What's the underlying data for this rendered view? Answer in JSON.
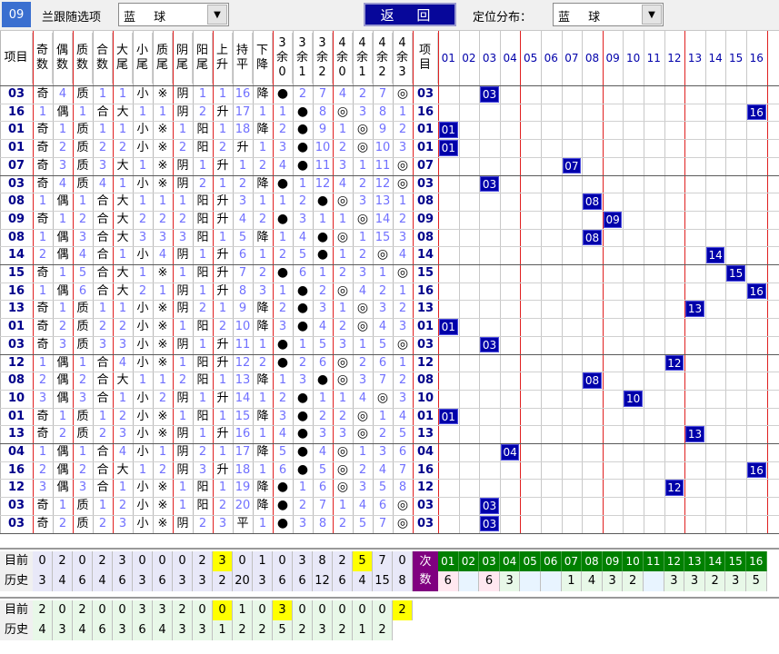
{
  "toolbar": {
    "issue": "09",
    "select_label": "兰跟随选项",
    "select_value": "蓝 球",
    "back_label": "返 回",
    "dist_label": "定位分布：",
    "dist_value": "蓝 球"
  },
  "headers": [
    "项目",
    "奇数",
    "偶数",
    "质数",
    "合数",
    "大尾",
    "小尾",
    "质尾",
    "阴尾",
    "阳尾",
    "上升",
    "持平",
    "下降",
    "3余0",
    "3余1",
    "3余2",
    "4余0",
    "4余1",
    "4余2",
    "4余3",
    "项目"
  ],
  "nums": [
    "01",
    "02",
    "03",
    "04",
    "05",
    "06",
    "07",
    "08",
    "09",
    "10",
    "11",
    "12",
    "13",
    "14",
    "15",
    "16"
  ],
  "rows": [
    [
      "03",
      "奇",
      "4",
      "质",
      "1",
      "1",
      "小",
      "※",
      "阴",
      "1",
      "1",
      "16",
      "降",
      "●",
      "2",
      "7",
      "4",
      "2",
      "7",
      "◎",
      "03"
    ],
    [
      "16",
      "1",
      "偶",
      "1",
      "合",
      "大",
      "1",
      "1",
      "阴",
      "2",
      "升",
      "17",
      "1",
      "1",
      "●",
      "8",
      "◎",
      "3",
      "8",
      "1",
      "16"
    ],
    [
      "01",
      "奇",
      "1",
      "质",
      "1",
      "1",
      "小",
      "※",
      "1",
      "阳",
      "1",
      "18",
      "降",
      "2",
      "●",
      "9",
      "1",
      "◎",
      "9",
      "2",
      "01"
    ],
    [
      "01",
      "奇",
      "2",
      "质",
      "2",
      "2",
      "小",
      "※",
      "2",
      "阳",
      "2",
      "升",
      "1",
      "3",
      "●",
      "10",
      "2",
      "◎",
      "10",
      "3",
      "01"
    ],
    [
      "07",
      "奇",
      "3",
      "质",
      "3",
      "大",
      "1",
      "※",
      "阴",
      "1",
      "升",
      "1",
      "2",
      "4",
      "●",
      "11",
      "3",
      "1",
      "11",
      "◎",
      "07"
    ],
    [
      "03",
      "奇",
      "4",
      "质",
      "4",
      "1",
      "小",
      "※",
      "阴",
      "2",
      "1",
      "2",
      "降",
      "●",
      "1",
      "12",
      "4",
      "2",
      "12",
      "◎",
      "03"
    ],
    [
      "08",
      "1",
      "偶",
      "1",
      "合",
      "大",
      "1",
      "1",
      "1",
      "阳",
      "升",
      "3",
      "1",
      "1",
      "2",
      "●",
      "◎",
      "3",
      "13",
      "1",
      "08"
    ],
    [
      "09",
      "奇",
      "1",
      "2",
      "合",
      "大",
      "2",
      "2",
      "2",
      "阳",
      "升",
      "4",
      "2",
      "●",
      "3",
      "1",
      "1",
      "◎",
      "14",
      "2",
      "09"
    ],
    [
      "08",
      "1",
      "偶",
      "3",
      "合",
      "大",
      "3",
      "3",
      "3",
      "阳",
      "1",
      "5",
      "降",
      "1",
      "4",
      "●",
      "◎",
      "1",
      "15",
      "3",
      "08"
    ],
    [
      "14",
      "2",
      "偶",
      "4",
      "合",
      "1",
      "小",
      "4",
      "阴",
      "1",
      "升",
      "6",
      "1",
      "2",
      "5",
      "●",
      "1",
      "2",
      "◎",
      "4",
      "14"
    ],
    [
      "15",
      "奇",
      "1",
      "5",
      "合",
      "大",
      "1",
      "※",
      "1",
      "阳",
      "升",
      "7",
      "2",
      "●",
      "6",
      "1",
      "2",
      "3",
      "1",
      "◎",
      "15"
    ],
    [
      "16",
      "1",
      "偶",
      "6",
      "合",
      "大",
      "2",
      "1",
      "阴",
      "1",
      "升",
      "8",
      "3",
      "1",
      "●",
      "2",
      "◎",
      "4",
      "2",
      "1",
      "16"
    ],
    [
      "13",
      "奇",
      "1",
      "质",
      "1",
      "1",
      "小",
      "※",
      "阴",
      "2",
      "1",
      "9",
      "降",
      "2",
      "●",
      "3",
      "1",
      "◎",
      "3",
      "2",
      "13"
    ],
    [
      "01",
      "奇",
      "2",
      "质",
      "2",
      "2",
      "小",
      "※",
      "1",
      "阳",
      "2",
      "10",
      "降",
      "3",
      "●",
      "4",
      "2",
      "◎",
      "4",
      "3",
      "01"
    ],
    [
      "03",
      "奇",
      "3",
      "质",
      "3",
      "3",
      "小",
      "※",
      "阴",
      "1",
      "升",
      "11",
      "1",
      "●",
      "1",
      "5",
      "3",
      "1",
      "5",
      "◎",
      "03"
    ],
    [
      "12",
      "1",
      "偶",
      "1",
      "合",
      "4",
      "小",
      "※",
      "1",
      "阳",
      "升",
      "12",
      "2",
      "●",
      "2",
      "6",
      "◎",
      "2",
      "6",
      "1",
      "12"
    ],
    [
      "08",
      "2",
      "偶",
      "2",
      "合",
      "大",
      "1",
      "1",
      "2",
      "阳",
      "1",
      "13",
      "降",
      "1",
      "3",
      "●",
      "◎",
      "3",
      "7",
      "2",
      "08"
    ],
    [
      "10",
      "3",
      "偶",
      "3",
      "合",
      "1",
      "小",
      "2",
      "阴",
      "1",
      "升",
      "14",
      "1",
      "2",
      "●",
      "1",
      "1",
      "4",
      "◎",
      "3",
      "10"
    ],
    [
      "01",
      "奇",
      "1",
      "质",
      "1",
      "2",
      "小",
      "※",
      "1",
      "阳",
      "1",
      "15",
      "降",
      "3",
      "●",
      "2",
      "2",
      "◎",
      "1",
      "4",
      "01"
    ],
    [
      "13",
      "奇",
      "2",
      "质",
      "2",
      "3",
      "小",
      "※",
      "阴",
      "1",
      "升",
      "16",
      "1",
      "4",
      "●",
      "3",
      "3",
      "◎",
      "2",
      "5",
      "13"
    ],
    [
      "04",
      "1",
      "偶",
      "1",
      "合",
      "4",
      "小",
      "1",
      "阴",
      "2",
      "1",
      "17",
      "降",
      "5",
      "●",
      "4",
      "◎",
      "1",
      "3",
      "6",
      "04"
    ],
    [
      "16",
      "2",
      "偶",
      "2",
      "合",
      "大",
      "1",
      "2",
      "阴",
      "3",
      "升",
      "18",
      "1",
      "6",
      "●",
      "5",
      "◎",
      "2",
      "4",
      "7",
      "16"
    ],
    [
      "12",
      "3",
      "偶",
      "3",
      "合",
      "1",
      "小",
      "※",
      "1",
      "阳",
      "1",
      "19",
      "降",
      "●",
      "1",
      "6",
      "◎",
      "3",
      "5",
      "8",
      "12"
    ],
    [
      "03",
      "奇",
      "1",
      "质",
      "1",
      "2",
      "小",
      "※",
      "1",
      "阳",
      "2",
      "20",
      "降",
      "●",
      "2",
      "7",
      "1",
      "4",
      "6",
      "◎",
      "03"
    ],
    [
      "03",
      "奇",
      "2",
      "质",
      "2",
      "3",
      "小",
      "※",
      "阴",
      "2",
      "3",
      "平",
      "1",
      "●",
      "3",
      "8",
      "2",
      "5",
      "7",
      "◎",
      "03"
    ]
  ],
  "footer1": {
    "cur_label": "目前",
    "cur": [
      "0",
      "2",
      "0",
      "2",
      "3",
      "0",
      "0",
      "0",
      "2",
      "3",
      "0",
      "1",
      "0",
      "3",
      "8",
      "2",
      "5",
      "7",
      "0"
    ],
    "his_label": "历史",
    "his": [
      "3",
      "4",
      "6",
      "4",
      "6",
      "3",
      "6",
      "3",
      "3",
      "2",
      "20",
      "3",
      "6",
      "6",
      "12",
      "6",
      "4",
      "15",
      "8"
    ],
    "count_label": "次数",
    "counts": [
      "6",
      "",
      "6",
      "3",
      "",
      "",
      "1",
      "4",
      "3",
      "2",
      "",
      "3",
      "3",
      "2",
      "3",
      "5"
    ]
  },
  "footer2": {
    "cur_label": "目前",
    "cur": [
      "2",
      "0",
      "2",
      "0",
      "0",
      "3",
      "3",
      "2",
      "0",
      "0",
      "1",
      "0",
      "3",
      "0",
      "0",
      "0",
      "0",
      "0",
      "2"
    ],
    "his_label": "历史",
    "his": [
      "4",
      "3",
      "4",
      "6",
      "3",
      "6",
      "4",
      "3",
      "3",
      "1",
      "2",
      "2",
      "5",
      "2",
      "3",
      "2",
      "1",
      "2"
    ]
  },
  "colors": {
    "issue_bg": "#3a6fd0",
    "back_bg": "#07079a",
    "ball": "#0000aa",
    "highlight": "#ffff00",
    "count_header": "#008000",
    "count_label_bg": "#800080"
  }
}
